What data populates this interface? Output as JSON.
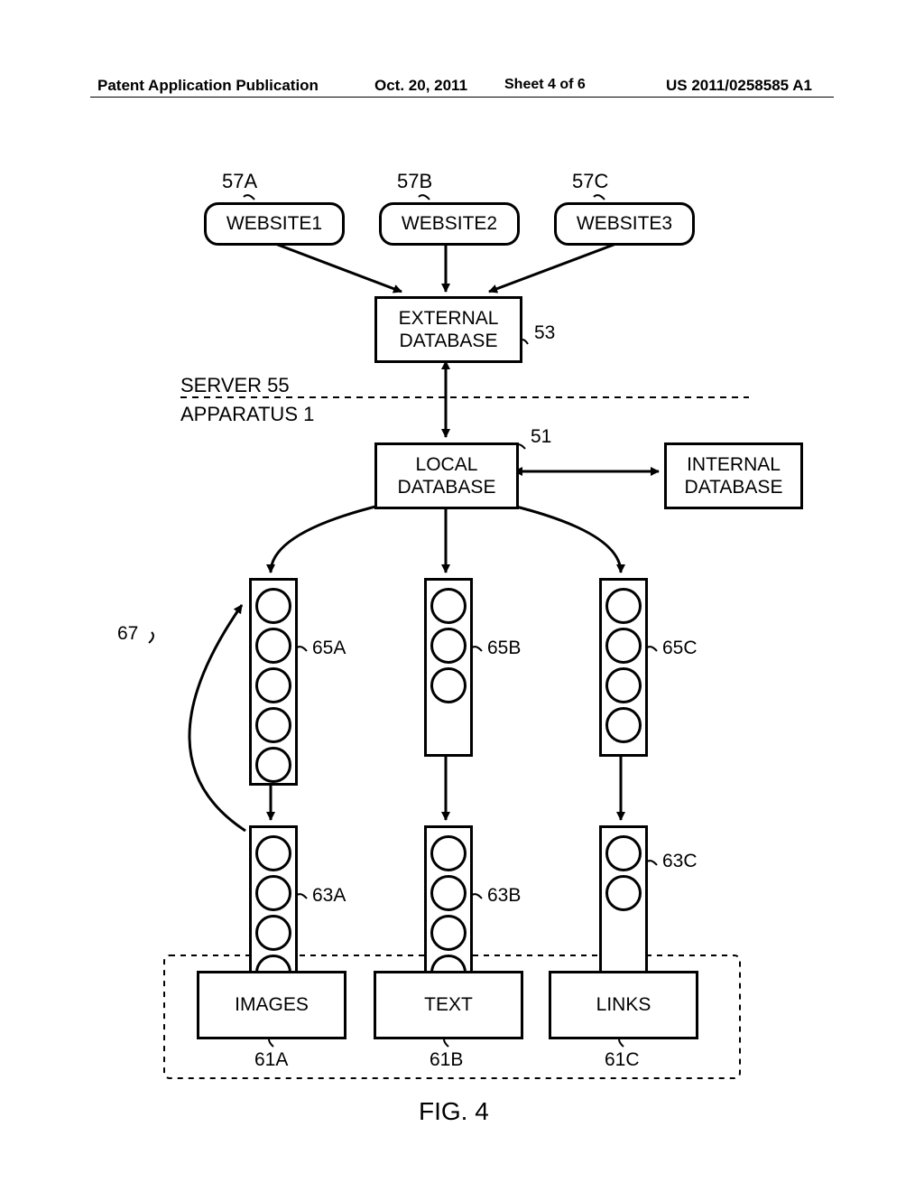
{
  "header": {
    "left": "Patent Application Publication",
    "date": "Oct. 20, 2011",
    "sheet": "Sheet 4 of 6",
    "pubno": "US 2011/0258585 A1"
  },
  "labels": {
    "l57A": "57A",
    "l57B": "57B",
    "l57C": "57C",
    "l53": "53",
    "l51": "51",
    "server": "SERVER 55",
    "apparatus": "APPARATUS 1",
    "l67": "67",
    "l65A": "65A",
    "l65B": "65B",
    "l65C": "65C",
    "l63A": "63A",
    "l63B": "63B",
    "l61A": "61A",
    "l61B": "61B",
    "l61C": "61C",
    "l63C": "63C",
    "fig": "FIG. 4"
  },
  "boxes": {
    "website1": "WEBSITE1",
    "website2": "WEBSITE2",
    "website3": "WEBSITE3",
    "external_db": "EXTERNAL\nDATABASE",
    "local_db": "LOCAL\nDATABASE",
    "internal_db": "INTERNAL\nDATABASE",
    "images": "IMAGES",
    "text": "TEXT",
    "links": "LINKS"
  }
}
